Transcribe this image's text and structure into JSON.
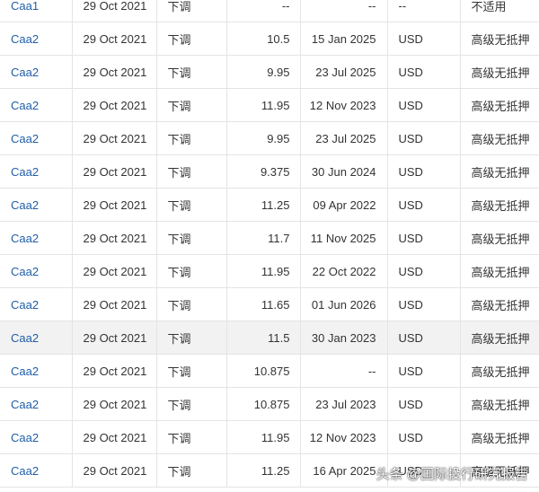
{
  "rows": [
    {
      "rating": "Caa1",
      "date": "29 Oct 2021",
      "direction": "下调",
      "coupon": "--",
      "maturity": "--",
      "currency": "--",
      "type": "不适用"
    },
    {
      "rating": "Caa2",
      "date": "29 Oct 2021",
      "direction": "下调",
      "coupon": "10.5",
      "maturity": "15 Jan 2025",
      "currency": "USD",
      "type": "高级无抵押"
    },
    {
      "rating": "Caa2",
      "date": "29 Oct 2021",
      "direction": "下调",
      "coupon": "9.95",
      "maturity": "23 Jul 2025",
      "currency": "USD",
      "type": "高级无抵押"
    },
    {
      "rating": "Caa2",
      "date": "29 Oct 2021",
      "direction": "下调",
      "coupon": "11.95",
      "maturity": "12 Nov 2023",
      "currency": "USD",
      "type": "高级无抵押"
    },
    {
      "rating": "Caa2",
      "date": "29 Oct 2021",
      "direction": "下调",
      "coupon": "9.95",
      "maturity": "23 Jul 2025",
      "currency": "USD",
      "type": "高级无抵押"
    },
    {
      "rating": "Caa2",
      "date": "29 Oct 2021",
      "direction": "下调",
      "coupon": "9.375",
      "maturity": "30 Jun 2024",
      "currency": "USD",
      "type": "高级无抵押"
    },
    {
      "rating": "Caa2",
      "date": "29 Oct 2021",
      "direction": "下调",
      "coupon": "11.25",
      "maturity": "09 Apr 2022",
      "currency": "USD",
      "type": "高级无抵押"
    },
    {
      "rating": "Caa2",
      "date": "29 Oct 2021",
      "direction": "下调",
      "coupon": "11.7",
      "maturity": "11 Nov 2025",
      "currency": "USD",
      "type": "高级无抵押"
    },
    {
      "rating": "Caa2",
      "date": "29 Oct 2021",
      "direction": "下调",
      "coupon": "11.95",
      "maturity": "22 Oct 2022",
      "currency": "USD",
      "type": "高级无抵押"
    },
    {
      "rating": "Caa2",
      "date": "29 Oct 2021",
      "direction": "下调",
      "coupon": "11.65",
      "maturity": "01 Jun 2026",
      "currency": "USD",
      "type": "高级无抵押"
    },
    {
      "rating": "Caa2",
      "date": "29 Oct 2021",
      "direction": "下调",
      "coupon": "11.5",
      "maturity": "30 Jan 2023",
      "currency": "USD",
      "type": "高级无抵押",
      "highlighted": true
    },
    {
      "rating": "Caa2",
      "date": "29 Oct 2021",
      "direction": "下调",
      "coupon": "10.875",
      "maturity": "--",
      "currency": "USD",
      "type": "高级无抵押"
    },
    {
      "rating": "Caa2",
      "date": "29 Oct 2021",
      "direction": "下调",
      "coupon": "10.875",
      "maturity": "23 Jul 2023",
      "currency": "USD",
      "type": "高级无抵押"
    },
    {
      "rating": "Caa2",
      "date": "29 Oct 2021",
      "direction": "下调",
      "coupon": "11.95",
      "maturity": "12 Nov 2023",
      "currency": "USD",
      "type": "高级无抵押"
    },
    {
      "rating": "Caa2",
      "date": "29 Oct 2021",
      "direction": "下调",
      "coupon": "11.25",
      "maturity": "16 Apr 2025",
      "currency": "USD",
      "type": "高级无抵押"
    }
  ],
  "watermark": "头条 @国际投行研究报告",
  "colors": {
    "link": "#1f5ea8",
    "highlight_row": "#f2f2f2",
    "grid": "#e4e4e4"
  }
}
